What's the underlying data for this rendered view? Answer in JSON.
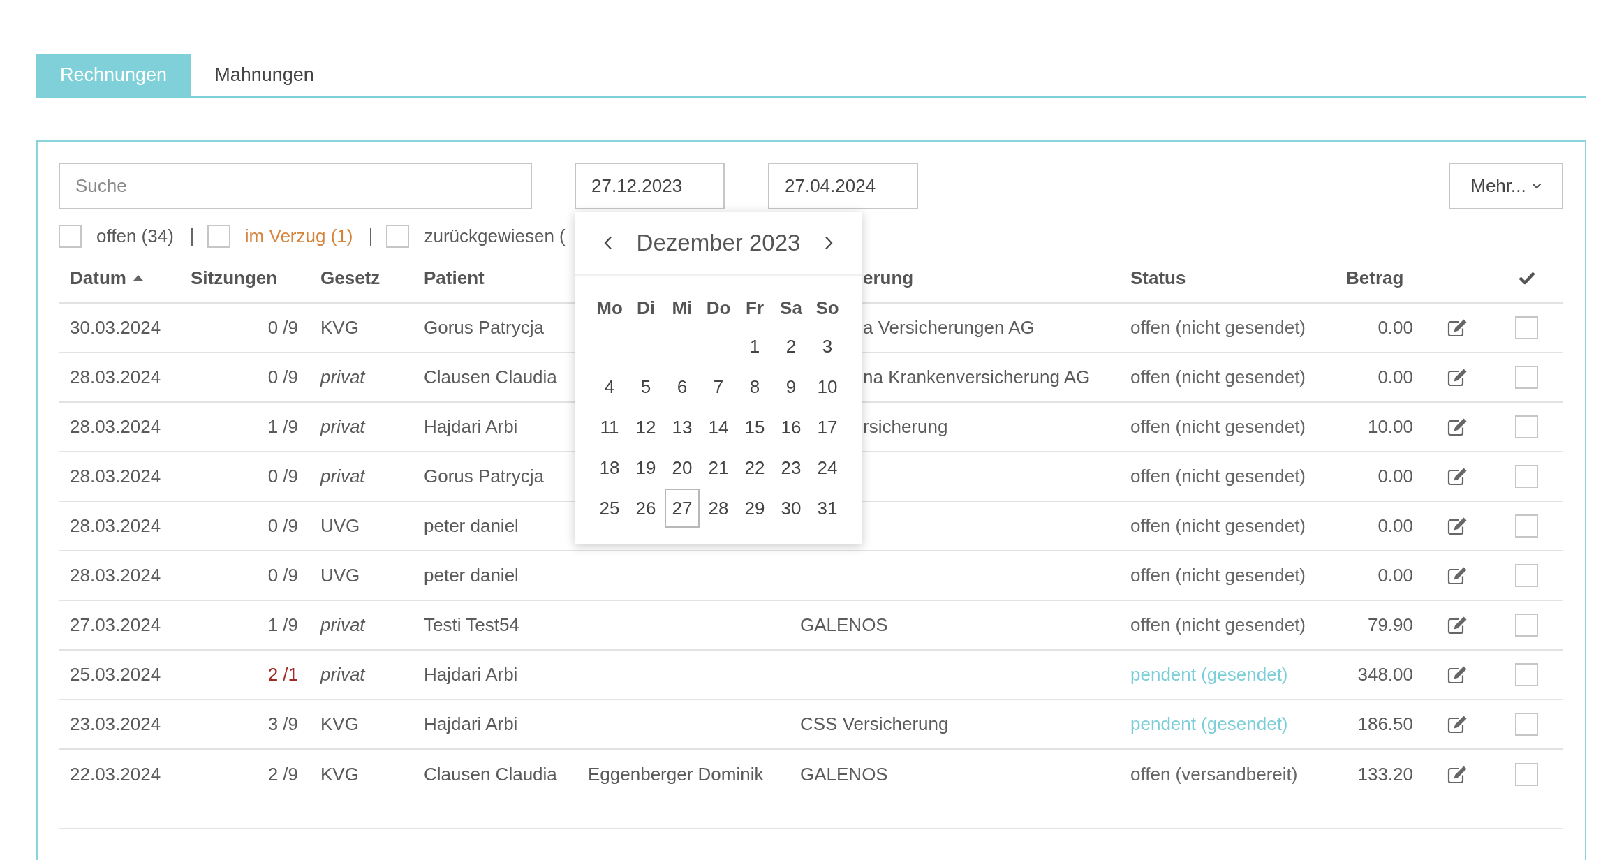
{
  "tabs": [
    {
      "label": "Rechnungen",
      "selected": true
    },
    {
      "label": "Mahnungen",
      "selected": false
    }
  ],
  "toolbar": {
    "search": {
      "placeholder": "Suche"
    },
    "date_from": "27.12.2023",
    "date_to": "27.04.2024",
    "more_button": "Mehr..."
  },
  "filters": [
    {
      "label": "offen (34)",
      "checked": false,
      "warning": false
    },
    {
      "label": "im Verzug (1)",
      "checked": false,
      "warning": true
    },
    {
      "label": "zurückgewiesen (",
      "checked": false,
      "warning": false
    }
  ],
  "table": {
    "columns": [
      {
        "label": "Datum",
        "sorted": true,
        "descending": false
      },
      {
        "label": "Sitzungen"
      },
      {
        "label": "Gesetz"
      },
      {
        "label": "Patient"
      },
      {},
      {
        "label": "erung"
      },
      {
        "label": "Status"
      },
      {
        "label": "Betrag"
      }
    ],
    "rows": [
      {
        "datum": "30.03.2024",
        "sitzungen": "0 /9",
        "sitzungen_over": false,
        "gesetz": "KVG",
        "gesetz_italic": false,
        "patient": "Gorus Patrycja",
        "versicherung": "a Versicherungen AG",
        "status": "offen (nicht gesendet)",
        "pending": false,
        "betrag": "0.00",
        "checked": false
      },
      {
        "datum": "28.03.2024",
        "sitzungen": "0 /9",
        "sitzungen_over": false,
        "gesetz": "privat",
        "gesetz_italic": true,
        "patient": "Clausen Claudia",
        "versicherung": "na Krankenversicherung AG",
        "status": "offen (nicht gesendet)",
        "pending": false,
        "betrag": "0.00",
        "checked": false
      },
      {
        "datum": "28.03.2024",
        "sitzungen": "1 /9",
        "sitzungen_over": false,
        "gesetz": "privat",
        "gesetz_italic": true,
        "patient": "Hajdari Arbi",
        "versicherung": "rsicherung",
        "status": "offen (nicht gesendet)",
        "pending": false,
        "betrag": "10.00",
        "checked": false
      },
      {
        "datum": "28.03.2024",
        "sitzungen": "0 /9",
        "sitzungen_over": false,
        "gesetz": "privat",
        "gesetz_italic": true,
        "patient": "Gorus Patrycja",
        "status": "offen (nicht gesendet)",
        "pending": false,
        "betrag": "0.00",
        "checked": false
      },
      {
        "datum": "28.03.2024",
        "sitzungen": "0 /9",
        "sitzungen_over": false,
        "gesetz": "UVG",
        "gesetz_italic": false,
        "patient": "peter daniel",
        "status": "offen (nicht gesendet)",
        "pending": false,
        "betrag": "0.00",
        "checked": false
      },
      {
        "datum": "28.03.2024",
        "sitzungen": "0 /9",
        "sitzungen_over": false,
        "gesetz": "UVG",
        "gesetz_italic": false,
        "patient": "peter daniel",
        "status": "offen (nicht gesendet)",
        "pending": false,
        "betrag": "0.00",
        "checked": false
      },
      {
        "datum": "27.03.2024",
        "sitzungen": "1 /9",
        "sitzungen_over": false,
        "gesetz": "privat",
        "gesetz_italic": true,
        "patient": "Testi Test54",
        "versicherung": "GALENOS",
        "status": "offen (nicht gesendet)",
        "pending": false,
        "betrag": "79.90",
        "checked": false
      },
      {
        "datum": "25.03.2024",
        "sitzungen": "2 /1",
        "sitzungen_over": true,
        "gesetz": "privat",
        "gesetz_italic": true,
        "patient": "Hajdari Arbi",
        "status": "pendent (gesendet)",
        "pending": true,
        "betrag": "348.00",
        "checked": false
      },
      {
        "datum": "23.03.2024",
        "sitzungen": "3 /9",
        "sitzungen_over": false,
        "gesetz": "KVG",
        "gesetz_italic": false,
        "patient": "Hajdari Arbi",
        "versicherung": "CSS Versicherung",
        "status": "pendent (gesendet)",
        "pending": true,
        "betrag": "186.50",
        "checked": false
      },
      {
        "datum": "22.03.2024",
        "sitzungen": "2 /9",
        "sitzungen_over": false,
        "gesetz": "KVG",
        "gesetz_italic": false,
        "patient": "Clausen Claudia",
        "zuweiser": "Eggenberger Dominik",
        "versicherung": "GALENOS",
        "status": "offen (versandbereit)",
        "pending": false,
        "betrag": "133.20",
        "checked": false
      }
    ]
  },
  "date_picker": {
    "month": "Dezember 2023",
    "weekdays": [
      "Mo",
      "Di",
      "Mi",
      "Do",
      "Fr",
      "Sa",
      "So"
    ],
    "weeks": [
      [
        {
          "day": "1",
          "selected": false
        },
        {
          "day": "2",
          "selected": false
        },
        {
          "day": "3",
          "selected": false
        }
      ],
      [
        {
          "day": "4",
          "selected": false
        },
        {
          "day": "5",
          "selected": false
        },
        {
          "day": "6",
          "selected": false
        },
        {
          "day": "7",
          "selected": false
        },
        {
          "day": "8",
          "selected": false
        },
        {
          "day": "9",
          "selected": false
        },
        {
          "day": "10",
          "selected": false
        }
      ],
      [
        {
          "day": "11",
          "selected": false
        },
        {
          "day": "12",
          "selected": false
        },
        {
          "day": "13",
          "selected": false
        },
        {
          "day": "14",
          "selected": false
        },
        {
          "day": "15",
          "selected": false
        },
        {
          "day": "16",
          "selected": false
        },
        {
          "day": "17",
          "selected": false
        }
      ],
      [
        {
          "day": "18",
          "selected": false
        },
        {
          "day": "19",
          "selected": false
        },
        {
          "day": "20",
          "selected": false
        },
        {
          "day": "21",
          "selected": false
        },
        {
          "day": "22",
          "selected": false
        },
        {
          "day": "23",
          "selected": false
        },
        {
          "day": "24",
          "selected": false
        }
      ],
      [
        {
          "day": "25",
          "selected": false
        },
        {
          "day": "26",
          "selected": false
        },
        {
          "day": "27",
          "selected": true
        },
        {
          "day": "28",
          "selected": false
        },
        {
          "day": "29",
          "selected": false
        },
        {
          "day": "30",
          "selected": false
        },
        {
          "day": "31",
          "selected": false
        }
      ]
    ]
  }
}
